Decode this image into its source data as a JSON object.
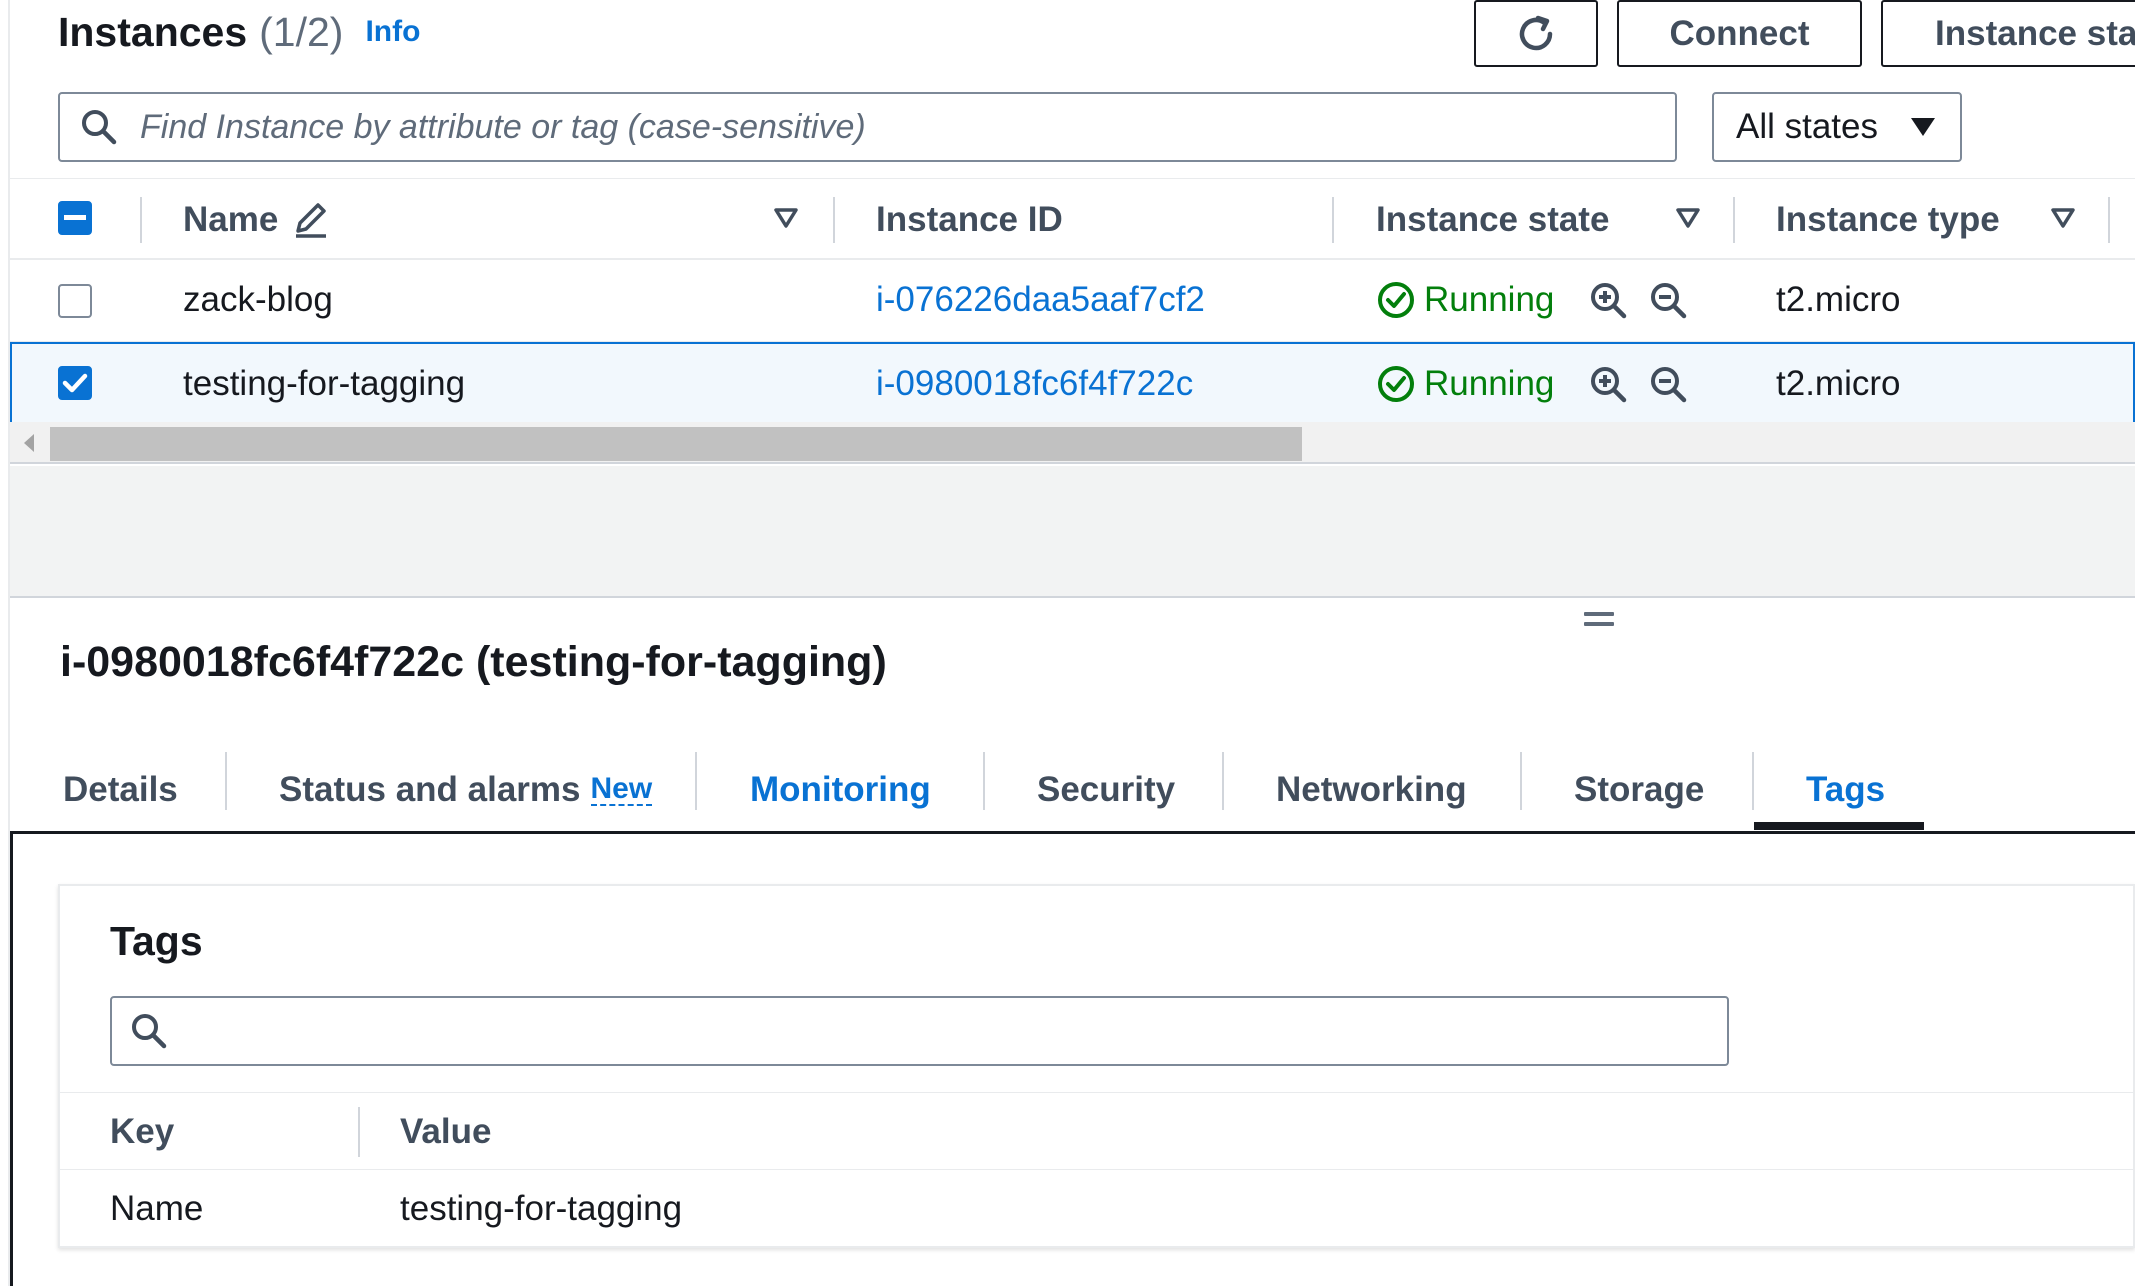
{
  "header": {
    "title": "Instances",
    "count": "(1/2)",
    "info_link": "Info",
    "buttons": {
      "connect": "Connect",
      "instance_state": "Instance state"
    }
  },
  "filter": {
    "search_placeholder": "Find Instance by attribute or tag (case-sensitive)",
    "state_select": "All states"
  },
  "table": {
    "columns": [
      "Name",
      "Instance ID",
      "Instance state",
      "Instance type"
    ],
    "rows": [
      {
        "name": "zack-blog",
        "instance_id": "i-076226daa5aaf7cf2",
        "state": "Running",
        "type": "t2.micro",
        "selected": false
      },
      {
        "name": "testing-for-tagging",
        "instance_id": "i-0980018fc6f4f722c",
        "state": "Running",
        "type": "t2.micro",
        "selected": true
      }
    ]
  },
  "details": {
    "title": "i-0980018fc6f4f722c (testing-for-tagging)",
    "tabs": [
      {
        "label": "Details"
      },
      {
        "label": "Status and alarms",
        "badge": "New"
      },
      {
        "label": "Monitoring"
      },
      {
        "label": "Security"
      },
      {
        "label": "Networking"
      },
      {
        "label": "Storage"
      },
      {
        "label": "Tags",
        "active": true
      }
    ]
  },
  "tags_panel": {
    "title": "Tags",
    "columns": [
      "Key",
      "Value"
    ],
    "rows": [
      {
        "key": "Name",
        "value": "testing-for-tagging"
      }
    ]
  },
  "colors": {
    "link": "#0972d3",
    "running": "#037f0c",
    "text": "#16191f",
    "muted": "#414d5c"
  }
}
